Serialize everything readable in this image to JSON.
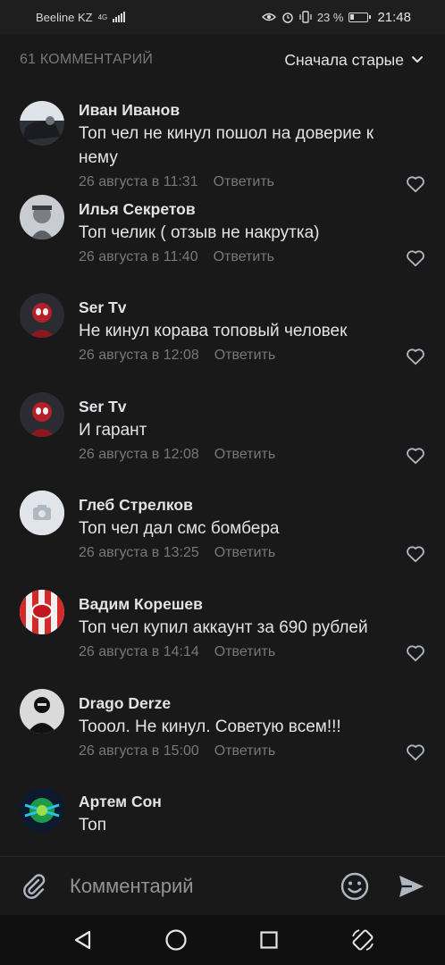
{
  "status_bar": {
    "carrier": "Beeline KZ",
    "network": "4G",
    "battery": "23 %",
    "time": "21:48"
  },
  "header": {
    "comment_count": "61 КОММЕНТАРИЙ",
    "sort_label": "Сначала старые"
  },
  "comments": [
    {
      "author": "Иван Иванов",
      "text": "Топ чел не кинул пошол на доверие к нему",
      "date": "26 августа в 11:31",
      "reply": "Ответить"
    },
    {
      "author": "Илья Секретов",
      "text": "Топ челик ( отзыв не накрутка)",
      "date": "26 августа в 11:40",
      "reply": "Ответить"
    },
    {
      "author": "Ser Tv",
      "text": "Не кинул корава топовый человек",
      "date": "26 августа в 12:08",
      "reply": "Ответить"
    },
    {
      "author": "Ser Tv",
      "text": "И гарант",
      "date": "26 августа в 12:08",
      "reply": "Ответить"
    },
    {
      "author": "Глеб Стрелков",
      "text": "Топ чел дал смс бомбера",
      "date": "26 августа в 13:25",
      "reply": "Ответить"
    },
    {
      "author": "Вадим Корешев",
      "text": "Топ чел купил аккаунт за 690 рублей",
      "date": "26 августа в 14:14",
      "reply": "Ответить"
    },
    {
      "author": "Drago Derze",
      "text": "Тооол. Не кинул. Советую всем!!!",
      "date": "26 августа в 15:00",
      "reply": "Ответить"
    },
    {
      "author": "Артем Сон",
      "text": "Топ",
      "date": "",
      "reply": ""
    }
  ],
  "input": {
    "placeholder": "Комментарий"
  },
  "colors": {
    "background": "#19191a",
    "secondary_text": "#76787a",
    "primary_text": "#e1e3e6",
    "icon": "#aeb7c2"
  }
}
